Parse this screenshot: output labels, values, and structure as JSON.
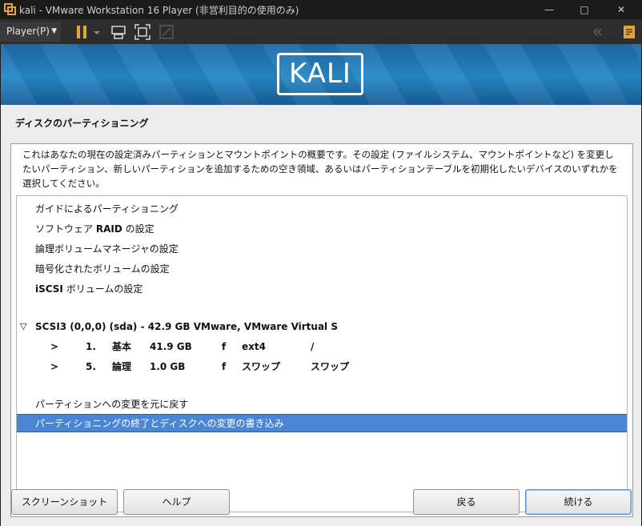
{
  "window": {
    "title": "kali - VMware Workstation 16 Player (非営利目的の使用のみ)",
    "controls": [
      "minimize-icon",
      "maximize-icon",
      "close-icon"
    ]
  },
  "toolbar": {
    "player_menu": "Player(P)",
    "icons": [
      "pause-icon",
      "dropdown-arrow-icon",
      "send-ctrl-alt-del-icon",
      "fullscreen-icon",
      "unity-icon",
      "back-arrows-icon",
      "library-icon"
    ],
    "accent": "#e8a23c"
  },
  "installer": {
    "logo_text": "KALI",
    "page_title": "ディスクのパーティショニング",
    "intro": "これはあなたの現在の設定済みパーティションとマウントポイントの概要です。その設定 (ファイルシステム、マウントポイントなど) を変更したいパーティション、新しいパーティションを追加するための空き領域、あるいはパーティションテーブルを初期化したいデバイスのいずれかを選択してください。",
    "menu_items": [
      {
        "label": "ガイドによるパーティショニング"
      },
      {
        "prefix": "ソフトウェア ",
        "bold": "RAID",
        "suffix": " の設定"
      },
      {
        "label": "論理ボリュームマネージャの設定"
      },
      {
        "label": "暗号化されたボリュームの設定"
      },
      {
        "bold": "iSCSI",
        "suffix": " ボリュームの設定"
      }
    ],
    "disk": {
      "expander": "▽",
      "label": "SCSI3 (0,0,0) (sda) - 42.9 GB VMware, VMware Virtual S"
    },
    "partitions": [
      {
        "arrow": ">",
        "num": "1.",
        "type": "基本",
        "size": "41.9 GB",
        "flag": "f",
        "fs": "ext4",
        "mount": "/"
      },
      {
        "arrow": ">",
        "num": "5.",
        "type": "論理",
        "size": "1.0 GB",
        "flag": "f",
        "fs": "スワップ",
        "mount": "スワップ"
      }
    ],
    "undo_label": "パーティションへの変更を元に戻す",
    "finish_label": "パーティショニングの終了とディスクへの変更の書き込み",
    "selection_color": "#4a86d4"
  },
  "buttons": {
    "screenshot": "スクリーンショット",
    "help": "ヘルプ",
    "back": "戻る",
    "continue": "続ける"
  }
}
